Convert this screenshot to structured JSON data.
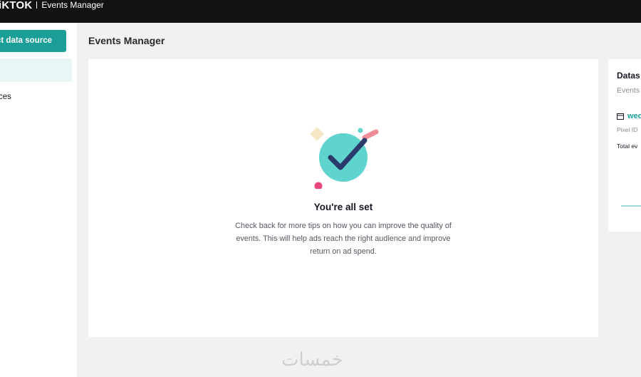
{
  "topbar": {
    "logo": "iKTOK",
    "product": "Events Manager"
  },
  "sidebar": {
    "connect_button": "ct data source",
    "items": [
      {
        "label": "ces"
      }
    ]
  },
  "page": {
    "title": "Events Manager"
  },
  "main_card": {
    "title": "You're all set",
    "description": "Check back for more tips on how you can improve the quality of events. This will help ads reach the right audience and improve return on ad spend."
  },
  "side_card": {
    "title": "Datas",
    "subtitle": "Events",
    "link": "wec",
    "pixel_label": "Pixel ID",
    "total_label": "Total ev",
    "icon": "calendar-icon"
  },
  "watermark": "خمسات",
  "colors": {
    "accent": "#1a9e97",
    "topbar": "#121212",
    "illustration_circle": "#5fd3cd",
    "check": "#2a3a6b",
    "dot_pink": "#e8467c"
  }
}
